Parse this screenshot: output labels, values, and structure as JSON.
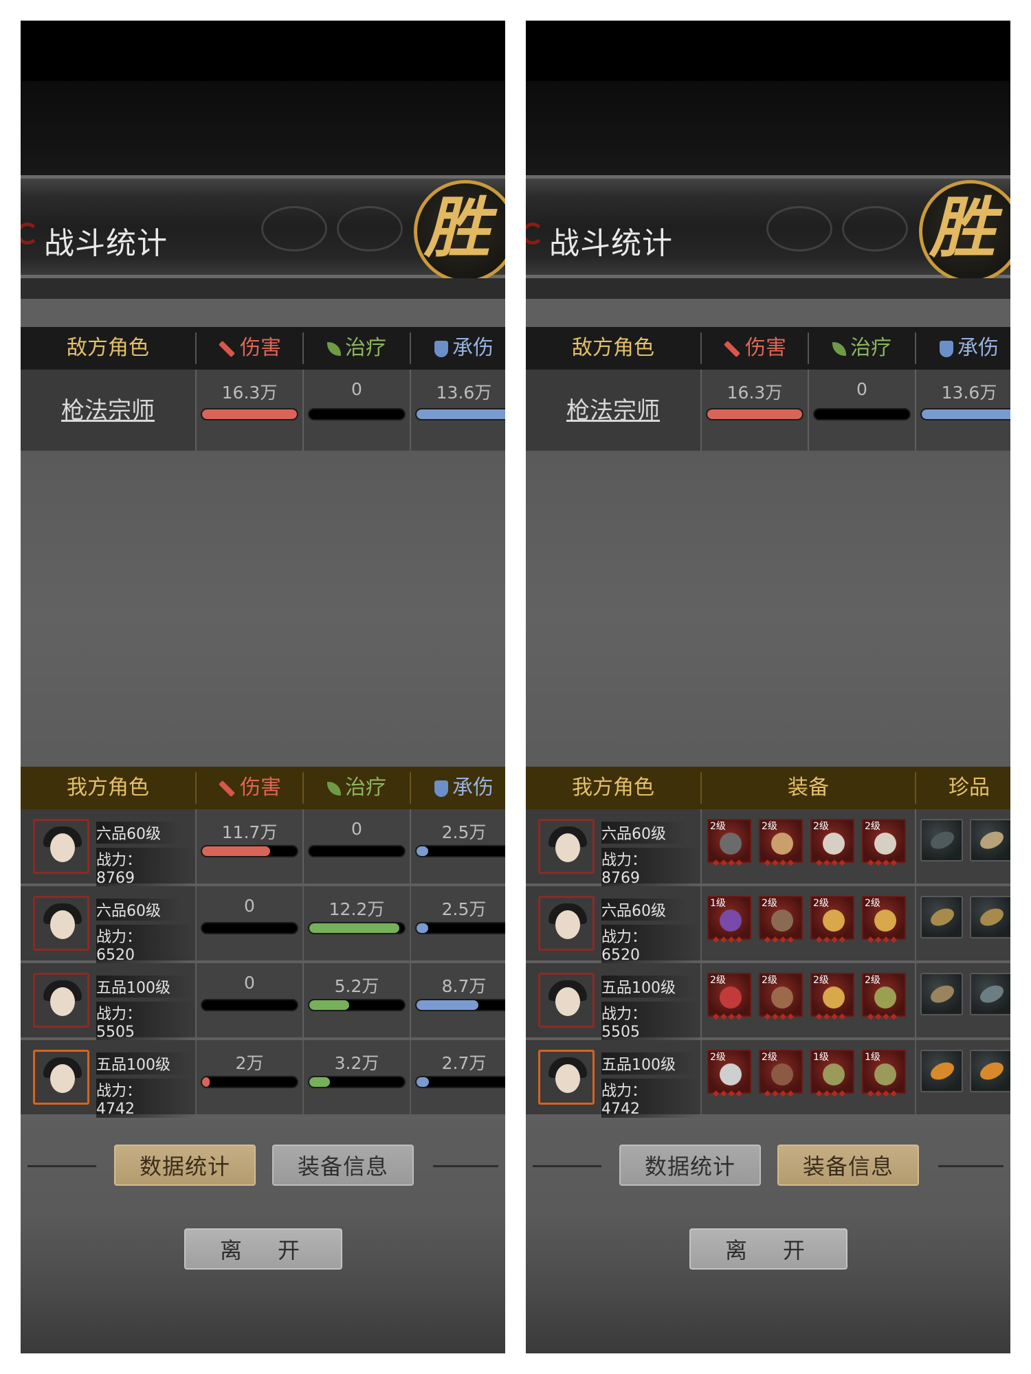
{
  "title": "战斗统计",
  "victory_glyph": "胜",
  "enemy_header": {
    "name": "敌方角色",
    "damage": "伤害",
    "heal": "治疗",
    "tank": "承伤"
  },
  "enemy": {
    "name": "枪法宗师",
    "damage": "16.3万",
    "heal": "0",
    "tank": "13.6万",
    "damage_fill": 1.0,
    "heal_fill": 0.0,
    "tank_fill": 1.0
  },
  "ally_header_stats": {
    "name": "我方角色",
    "damage": "伤害",
    "heal": "治疗",
    "tank": "承伤"
  },
  "ally_header_equip": {
    "name": "我方角色",
    "equipment": "装备",
    "treasure": "珍品"
  },
  "allies": [
    {
      "rank": "六品60级",
      "power_label": "战力：",
      "power": "8769",
      "damage": "11.7万",
      "heal": "0",
      "tank": "2.5万",
      "damage_fill": 0.72,
      "heal_fill": 0.0,
      "tank_fill": 0.12,
      "equipment": [
        {
          "level": "2级",
          "color": "#6b6b6b"
        },
        {
          "level": "2级",
          "color": "#c9a06a"
        },
        {
          "level": "2级",
          "color": "#d8cfc4"
        },
        {
          "level": "2级",
          "color": "#d8cfc4"
        }
      ],
      "treasures": [
        {
          "color": "#4f5a5c"
        },
        {
          "color": "#b7a27a"
        }
      ]
    },
    {
      "rank": "六品60级",
      "power_label": "战力：",
      "power": "6520",
      "damage": "0",
      "heal": "12.2万",
      "tank": "2.5万",
      "damage_fill": 0.0,
      "heal_fill": 0.95,
      "tank_fill": 0.12,
      "equipment": [
        {
          "level": "1级",
          "color": "#7a4aa8"
        },
        {
          "level": "2级",
          "color": "#8b6a52"
        },
        {
          "level": "2级",
          "color": "#d8a84a"
        },
        {
          "level": "2级",
          "color": "#d8a84a"
        }
      ],
      "treasures": [
        {
          "color": "#a88a4c"
        },
        {
          "color": "#a88a4c"
        }
      ]
    },
    {
      "rank": "五品100级",
      "power_label": "战力：",
      "power": "5505",
      "damage": "0",
      "heal": "5.2万",
      "tank": "8.7万",
      "damage_fill": 0.0,
      "heal_fill": 0.42,
      "tank_fill": 0.65,
      "equipment": [
        {
          "level": "2级",
          "color": "#c23a3a"
        },
        {
          "level": "2级",
          "color": "#9a6a4a"
        },
        {
          "level": "2级",
          "color": "#d8a84a"
        },
        {
          "level": "2级",
          "color": "#9aa050"
        }
      ],
      "treasures": [
        {
          "color": "#9a8460"
        },
        {
          "color": "#6d7d84"
        }
      ]
    },
    {
      "rank": "五品100级",
      "power_label": "战力：",
      "power": "4742",
      "damage": "2万",
      "heal": "3.2万",
      "tank": "2.7万",
      "damage_fill": 0.08,
      "heal_fill": 0.22,
      "tank_fill": 0.13,
      "equipment": [
        {
          "level": "2级",
          "color": "#cfcfcf"
        },
        {
          "level": "2级",
          "color": "#8b5a44"
        },
        {
          "level": "1级",
          "color": "#9a9a5a"
        },
        {
          "level": "1级",
          "color": "#9a9a5a"
        }
      ],
      "treasures": [
        {
          "color": "#d88a2a"
        },
        {
          "color": "#d88a2a"
        }
      ]
    }
  ],
  "buttons": {
    "stats": "数据统计",
    "equipment": "装备信息",
    "leave": "离　开"
  },
  "colors": {
    "damage": "#d9655a",
    "heal": "#77b05a",
    "tank": "#7a9bcf"
  }
}
